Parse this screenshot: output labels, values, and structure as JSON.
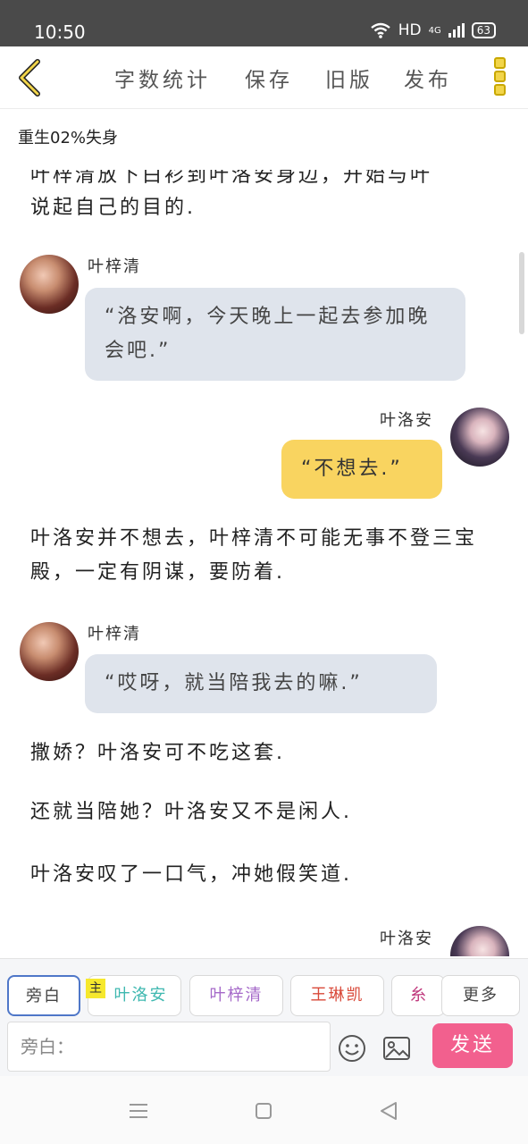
{
  "status_bar": {
    "time": "10:50",
    "network": "HD",
    "signal_label": "4G",
    "battery": "63"
  },
  "toolbar": {
    "word_count": "字数统计",
    "save": "保存",
    "old_version": "旧版",
    "publish": "发布"
  },
  "document": {
    "title": "重生02%失身"
  },
  "content": {
    "cut_off_line": "叶梓清放下白衫到叶洛安身边，开始与叶",
    "intro_line": "说起自己的目的.",
    "messages": [
      {
        "speaker": "叶梓清",
        "text": "“洛安啊，今天晚上一起去参加晚会吧.”"
      },
      {
        "speaker": "叶洛安",
        "text": "“不想去.”"
      },
      {
        "speaker": "叶梓清",
        "text": "“哎呀，就当陪我去的嘛.”"
      },
      {
        "speaker": "叶洛安"
      }
    ],
    "narration_1": "叶洛安并不想去，叶梓清不可能无事不登三宝殿，一定有阴谋，要防着.",
    "narration_2": "撒娇？叶洛安可不吃这套.",
    "narration_3": "还就当陪她？叶洛安又不是闲人.",
    "narration_4": "叶洛安叹了一口气，冲她假笑道."
  },
  "role_bar": {
    "aside": "旁白",
    "main_tag": "主",
    "roles": [
      {
        "name": "叶洛安",
        "color": "#3fb8b0"
      },
      {
        "name": "叶梓清",
        "color": "#a569c9"
      },
      {
        "name": "王琳凯",
        "color": "#d94a3a"
      },
      {
        "name": "糸统",
        "color": "#c0397d"
      }
    ],
    "more": "更多"
  },
  "input": {
    "placeholder": "旁白：",
    "send": "发送"
  }
}
